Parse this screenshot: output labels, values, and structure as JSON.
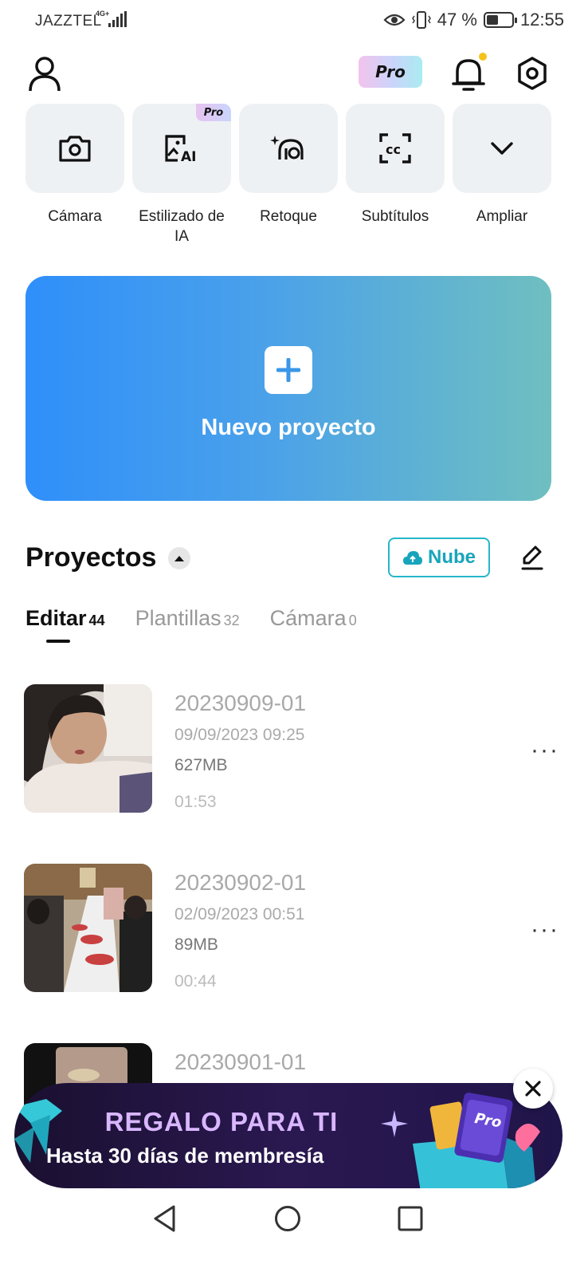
{
  "status": {
    "carrier": "JAZZTEL",
    "network": "4G+",
    "battery_text": "47 %",
    "battery_level": 0.47,
    "time": "12:55"
  },
  "header": {
    "pro_label": "Pro"
  },
  "tools": [
    {
      "label": "Cámara",
      "icon": "camera-icon",
      "pro": false
    },
    {
      "label": "Estilizado de IA",
      "icon": "ai-style-icon",
      "pro": true,
      "pro_label": "Pro"
    },
    {
      "label": "Retoque",
      "icon": "retouch-icon",
      "pro": false
    },
    {
      "label": "Subtítulos",
      "icon": "captions-icon",
      "pro": false
    },
    {
      "label": "Ampliar",
      "icon": "chevron-down-icon",
      "pro": false
    }
  ],
  "new_project": {
    "label": "Nuevo proyecto"
  },
  "projects": {
    "title": "Proyectos",
    "cloud_label": "Nube",
    "tabs": [
      {
        "label": "Editar",
        "count": "44",
        "active": true
      },
      {
        "label": "Plantillas",
        "count": "32",
        "active": false
      },
      {
        "label": "Cámara",
        "count": "0",
        "active": false
      }
    ],
    "items": [
      {
        "name": "20230909-01",
        "date": "09/09/2023 09:25",
        "size": "627MB",
        "duration": "01:53",
        "more": "···"
      },
      {
        "name": "20230902-01",
        "date": "02/09/2023 00:51",
        "size": "89MB",
        "duration": "00:44",
        "more": "···"
      },
      {
        "name": "20230901-01"
      }
    ]
  },
  "promo": {
    "title": "REGALO PARA TI",
    "subtitle": "Hasta 30 días de membresía",
    "badge": "Pro"
  },
  "colors": {
    "accent_teal": "#27b6c8",
    "gradient_start": "#2f8ffa",
    "gradient_end": "#6fbfc0",
    "notification_dot": "#f4c31a"
  }
}
